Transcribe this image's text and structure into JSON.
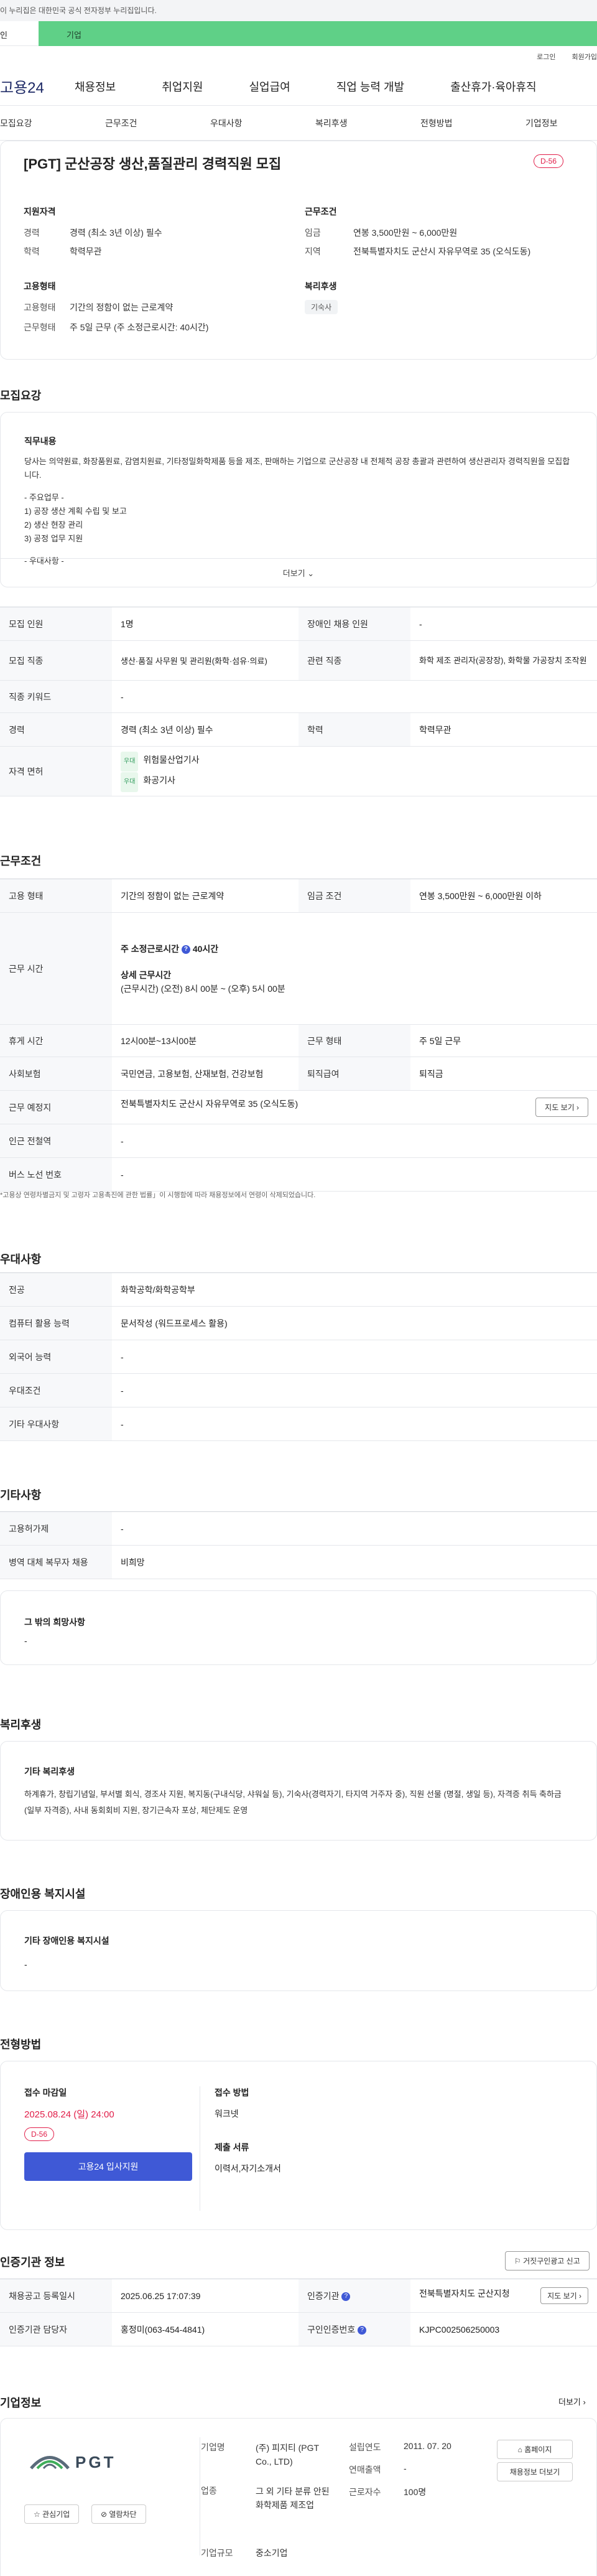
{
  "top_notice": "이 누리집은 대한민국 공식 전자정부 누리집입니다.",
  "tabs": {
    "left": "인",
    "right": "기업"
  },
  "util": {
    "login": "로그인",
    "signup": "회원가입"
  },
  "gnb": {
    "logo": "고용24",
    "items": [
      "채용정보",
      "취업지원",
      "실업급여",
      "직업 능력 개발",
      "출산휴가·육아휴직"
    ]
  },
  "subnav": [
    "모집요강",
    "근무조건",
    "우대사항",
    "복리후생",
    "전형방법",
    "기업정보"
  ],
  "job": {
    "title": "[PGT] 군산공장 생산,품질관리 경력직원 모집",
    "dday": "D-56",
    "qual_h": "지원자격",
    "career_l": "경력",
    "career_v": "경력 (최소 3년 이상) 필수",
    "edu_l": "학력",
    "edu_v": "학력무관",
    "cond_h": "근무조건",
    "wage_l": "임금",
    "wage_v": "연봉 3,500만원 ~ 6,000만원",
    "area_l": "지역",
    "area_v": "전북특별자치도 군산시 자유무역로 35 (오식도동)",
    "emp_h": "고용형태",
    "etype_l": "고용형태",
    "etype_v": "기간의 정함이 없는 근로계약",
    "wtype_l": "근무형태",
    "wtype_v": "주 5일 근무 (주 소정근로시간: 40시간)",
    "welfare_h": "복리후생",
    "welfare_pill": "기숙사"
  },
  "recruit": {
    "section_title": "모집요강",
    "duty_h": "직무내용",
    "duty_text": "당사는 의약원료, 화장품원료, 감염치원료, 기타정밀화학제품 등을 제조, 판매하는 기업으로 군산공장 내 전체적 공장 총괄과 관련하여 생산관리자 경력직원을 모집합니다.",
    "duty_l1": "- 주요업무 -",
    "duty_l2": "1) 공장 생산 계획 수립 및 보고",
    "duty_l3": "2) 생산 현장 관리",
    "duty_l4": "3) 공정 업무 지원",
    "duty_l5": "- 우대사항 -",
    "more": "더보기",
    "rows": {
      "count_l": "모집 인원",
      "count_v": "1명",
      "disab_l": "장애인 채용 인원",
      "disab_v": "-",
      "job_l": "모집 직종",
      "job_v": "생산·품질 사무원 및 관리원(화학·섬유·의료)",
      "rel_l": "관련 직종",
      "rel_v": "화학 제조 관리자(공장장), 화학물 가공장치 조작원",
      "kw_l": "직종 키워드",
      "kw_v": "-",
      "career_l": "경력",
      "career_v": "경력 (최소 3년 이상) 필수",
      "edu_l": "학력",
      "edu_v": "학력무관",
      "lic_l": "자격 면허",
      "lic_badge": "우대",
      "lic1": "위험물산업기사",
      "lic2": "화공기사"
    }
  },
  "work": {
    "section_title": "근무조건",
    "etype_l": "고용 형태",
    "etype_v": "기간의 정함이 없는 근로계약",
    "wage_l": "임금 조건",
    "wage_v": "연봉 3,500만원 ~ 6,000만원 이하",
    "time_l": "근무 시간",
    "time_v1": "주 소정근로시간",
    "time_v1b": "40시간",
    "time_v2": "상세 근무시간",
    "time_v3": "(근무시간) (오전) 8시 00분 ~ (오후) 5시 00분",
    "break_l": "휴게 시간",
    "break_v": "12시00분~13시00분",
    "wtype_l": "근무 형태",
    "wtype_v": "주 5일 근무",
    "ins_l": "사회보험",
    "ins_v": "국민연금, 고용보험, 산재보험, 건강보험",
    "ret_l": "퇴직급여",
    "ret_v": "퇴직금",
    "place_l": "근무 예정지",
    "place_v": "전북특별자치도 군산시 자유무역로 35 (오식도동)",
    "map_btn": "지도 보기",
    "sub_l": "인근 전철역",
    "sub_v": "-",
    "bus_l": "버스 노선 번호",
    "bus_v": "-",
    "note": "*고용상 연령차별금지 및 고령자 고용촉진에 관한 법률」이 시행함에 따라 채용정보에서 연령이 삭제되었습니다."
  },
  "pref": {
    "section_title": "우대사항",
    "major_l": "전공",
    "major_v": "화학공학/화학공학부",
    "pc_l": "컴퓨터 활용 능력",
    "pc_v": "문서작성 (워드프로세스 활용)",
    "lang_l": "외국어 능력",
    "lang_v": "-",
    "cond_l": "우대조건",
    "cond_v": "-",
    "etc_l": "기타 우대사항",
    "etc_v": "-"
  },
  "other": {
    "section_title": "기타사항",
    "emp_l": "고용허가제",
    "emp_v": "-",
    "mil_l": "병역 대체 복무자 채용",
    "mil_v": "비희망",
    "wish_h": "그 밖의 희망사항",
    "wish_v": "-"
  },
  "welfare": {
    "section_title": "복리후생",
    "h": "기타 복리후생",
    "text": "하계휴가, 창립기념일, 부서별 회식, 경조사 지원, 복지동(구내식당, 샤워실 등), 기숙사(경력자기, 타지역 거주자 중), 직원 선물 (명절, 생일 등), 자격증 취득 축하금(일부 자격증), 사내 동회회비 지원, 장기근속자 포상, 체단제도 운영"
  },
  "disabled": {
    "section_title": "장애인용 복지시설",
    "h": "기타 장애인용 복지시설",
    "v": "-"
  },
  "process": {
    "section_title": "전형방법",
    "deadline_h": "접수 마감일",
    "deadline_v": "2025.08.24 (일) 24:00",
    "dday": "D-56",
    "apply_btn": "고용24 입사지원",
    "method_h": "접수 방법",
    "method_v": "워크넷",
    "docs_h": "제출 서류",
    "docs_v": "이력서,자기소개서"
  },
  "auth": {
    "section_title": "인증기관 정보",
    "report_btn": "거짓구인광고 신고",
    "reg_l": "채용공고 등록일시",
    "reg_v": "2025.06.25 17:07:39",
    "org_l": "인증기관",
    "org_v": "전북특별자치도 군산지청",
    "map_btn": "지도 보기",
    "mgr_l": "인증기관 담당자",
    "mgr_v": "홍정미(063-454-4841)",
    "no_l": "구인인증번호",
    "no_v": "KJPC002506250003"
  },
  "company": {
    "section_title": "기업정보",
    "more": "더보기",
    "logo_text": "PGT",
    "fav_btn": "관심기업",
    "block_btn": "열람차단",
    "name_l": "기업명",
    "name_v": "(주) 피지티 (PGT Co., LTD)",
    "ind_l": "업종",
    "ind_v": "그 외 기타 분류 안된 화학제품 제조업",
    "size_l": "기업규모",
    "size_v": "중소기업",
    "est_l": "설립연도",
    "est_v": "2011. 07. 20",
    "sales_l": "연매출액",
    "sales_v": "-",
    "staff_l": "근로자수",
    "staff_v": "100명",
    "home_btn": "홈페이지",
    "jobs_btn": "채용정보 더보기"
  }
}
